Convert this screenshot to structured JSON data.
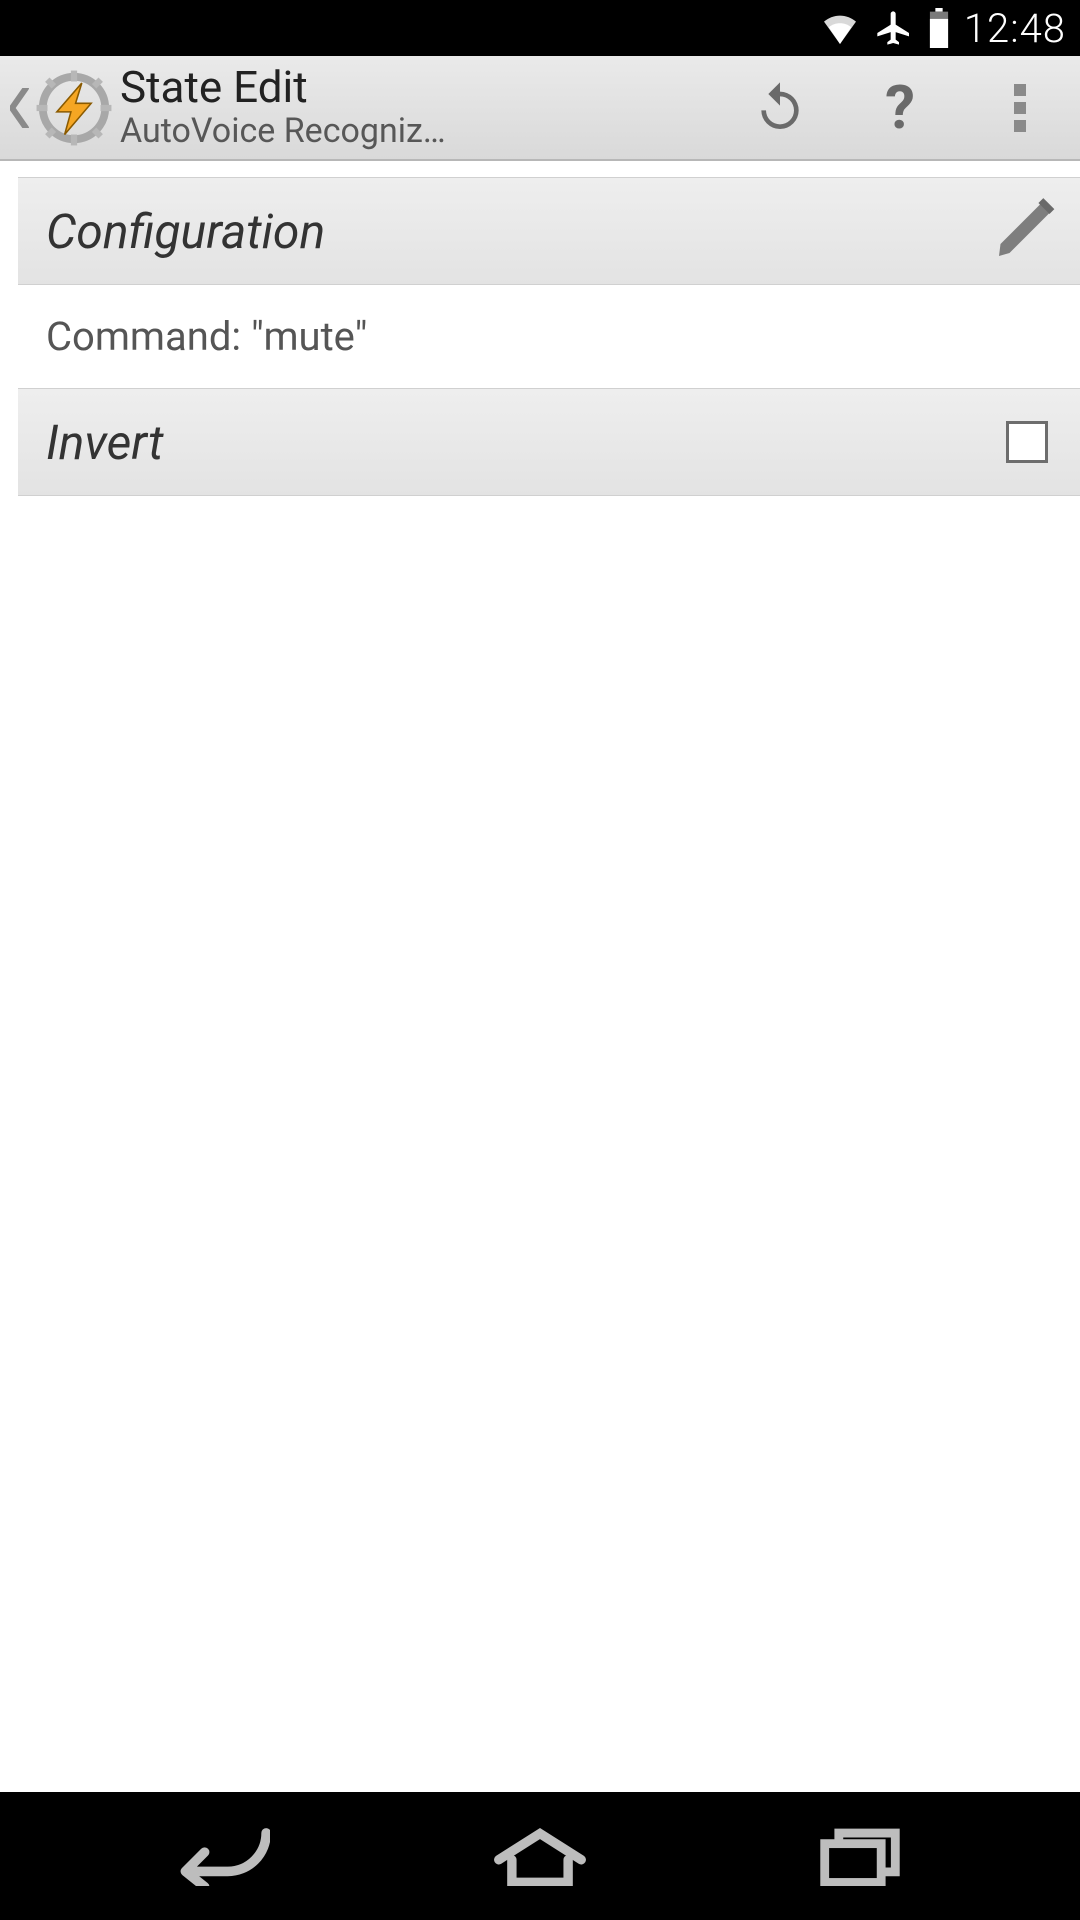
{
  "status": {
    "time": "12:48",
    "icons": {
      "wifi": "wifi-icon",
      "airplane": "airplane-icon",
      "battery": "battery-icon"
    }
  },
  "action_bar": {
    "title": "State Edit",
    "subtitle": "AutoVoice Recogniz…",
    "buttons": {
      "revert": "revert-icon",
      "help": "?",
      "overflow": "overflow-icon"
    }
  },
  "sections": {
    "configuration": {
      "label": "Configuration",
      "value": "Command: \"mute\"",
      "edit_icon": "pencil-icon"
    },
    "invert": {
      "label": "Invert",
      "checked": false
    }
  },
  "nav": {
    "back": "back-icon",
    "home": "home-icon",
    "recent": "recent-icon"
  }
}
